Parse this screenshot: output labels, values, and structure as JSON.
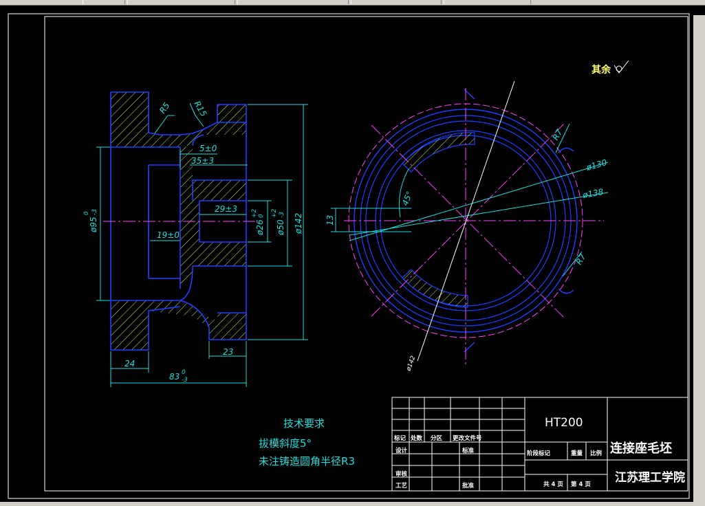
{
  "drawing": {
    "surface_note": "其余",
    "dims_left": {
      "r5": "R5",
      "r15": "R15",
      "d5": "5±0",
      "d35": "35±3",
      "d29": "29±3",
      "d19": "19±0",
      "d95": "ø95",
      "d95_tol": "0",
      "d95_tol2": "-3",
      "d26": "ø26",
      "d26_tol": "+2",
      "d26_tol2": "0",
      "d50": "ø50",
      "d50_tol": "+2",
      "d50_tol2": "-3",
      "d142": "ø142",
      "d24": "24",
      "d23": "23",
      "d83": "83",
      "d83_tol": "0",
      "d83_tol2": "-3"
    },
    "dims_right": {
      "r7a": "R7",
      "r7b": "R7",
      "d130": "ø130",
      "d138": "ø138",
      "d13": "13",
      "a45": "45°",
      "d142": "ø142"
    },
    "tech_title": "技术要求",
    "tech_line1": "拔模斜度5°",
    "tech_line2": "未注铸造圆角半径R3"
  },
  "titleblock": {
    "material": "HT200",
    "part_name": "连接座毛坯",
    "school": "江苏理工学院",
    "h_mark": "标记",
    "h_count": "处数",
    "h_zone": "分区",
    "h_docno": "更改文件号",
    "design": "设计",
    "standard": "标准",
    "check": "审核",
    "process": "工艺",
    "approve": "批准",
    "stage_mark": "阶段标记",
    "weight": "重量",
    "scale": "比例",
    "sheets_total": "共 4 页",
    "sheet_no": "第 4 页"
  }
}
